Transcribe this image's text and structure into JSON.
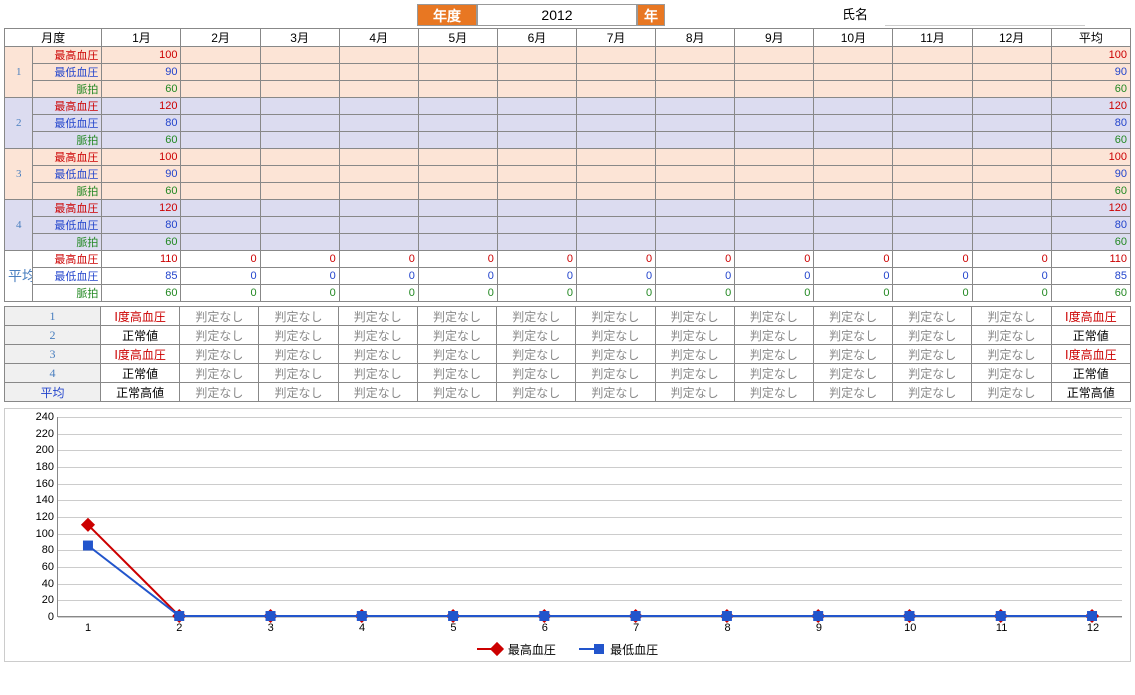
{
  "header": {
    "year_label": "年度",
    "year_value": "2012",
    "year_suffix": "年",
    "name_label": "氏名"
  },
  "columns": {
    "month_header": "月度",
    "months": [
      "1月",
      "2月",
      "3月",
      "4月",
      "5月",
      "6月",
      "7月",
      "8月",
      "9月",
      "10月",
      "11月",
      "12月"
    ],
    "avg": "平均"
  },
  "metrics": {
    "high": "最高血圧",
    "low": "最低血圧",
    "pulse": "脈拍"
  },
  "weeks": [
    {
      "num": "1",
      "bg": "peach",
      "high": [
        "100",
        "",
        "",
        "",
        "",
        "",
        "",
        "",
        "",
        "",
        "",
        "",
        "100"
      ],
      "low": [
        "90",
        "",
        "",
        "",
        "",
        "",
        "",
        "",
        "",
        "",
        "",
        "",
        "90"
      ],
      "pulse": [
        "60",
        "",
        "",
        "",
        "",
        "",
        "",
        "",
        "",
        "",
        "",
        "",
        "60"
      ]
    },
    {
      "num": "2",
      "bg": "lav",
      "high": [
        "120",
        "",
        "",
        "",
        "",
        "",
        "",
        "",
        "",
        "",
        "",
        "",
        "120"
      ],
      "low": [
        "80",
        "",
        "",
        "",
        "",
        "",
        "",
        "",
        "",
        "",
        "",
        "",
        "80"
      ],
      "pulse": [
        "60",
        "",
        "",
        "",
        "",
        "",
        "",
        "",
        "",
        "",
        "",
        "",
        "60"
      ]
    },
    {
      "num": "3",
      "bg": "peach",
      "high": [
        "100",
        "",
        "",
        "",
        "",
        "",
        "",
        "",
        "",
        "",
        "",
        "",
        "100"
      ],
      "low": [
        "90",
        "",
        "",
        "",
        "",
        "",
        "",
        "",
        "",
        "",
        "",
        "",
        "90"
      ],
      "pulse": [
        "60",
        "",
        "",
        "",
        "",
        "",
        "",
        "",
        "",
        "",
        "",
        "",
        "60"
      ]
    },
    {
      "num": "4",
      "bg": "lav",
      "high": [
        "120",
        "",
        "",
        "",
        "",
        "",
        "",
        "",
        "",
        "",
        "",
        "",
        "120"
      ],
      "low": [
        "80",
        "",
        "",
        "",
        "",
        "",
        "",
        "",
        "",
        "",
        "",
        "",
        "80"
      ],
      "pulse": [
        "60",
        "",
        "",
        "",
        "",
        "",
        "",
        "",
        "",
        "",
        "",
        "",
        "60"
      ]
    }
  ],
  "avg_row": {
    "label": "平均",
    "high": [
      "110",
      "0",
      "0",
      "0",
      "0",
      "0",
      "0",
      "0",
      "0",
      "0",
      "0",
      "0",
      "110"
    ],
    "low": [
      "85",
      "0",
      "0",
      "0",
      "0",
      "0",
      "0",
      "0",
      "0",
      "0",
      "0",
      "0",
      "85"
    ],
    "pulse": [
      "60",
      "0",
      "0",
      "0",
      "0",
      "0",
      "0",
      "0",
      "0",
      "0",
      "0",
      "0",
      "60"
    ]
  },
  "judgement": {
    "rows": [
      {
        "label": "1",
        "vals": [
          "Ⅰ度高血圧",
          "判定なし",
          "判定なし",
          "判定なし",
          "判定なし",
          "判定なし",
          "判定なし",
          "判定なし",
          "判定なし",
          "判定なし",
          "判定なし",
          "判定なし",
          "Ⅰ度高血圧"
        ]
      },
      {
        "label": "2",
        "vals": [
          "正常値",
          "判定なし",
          "判定なし",
          "判定なし",
          "判定なし",
          "判定なし",
          "判定なし",
          "判定なし",
          "判定なし",
          "判定なし",
          "判定なし",
          "判定なし",
          "正常値"
        ]
      },
      {
        "label": "3",
        "vals": [
          "Ⅰ度高血圧",
          "判定なし",
          "判定なし",
          "判定なし",
          "判定なし",
          "判定なし",
          "判定なし",
          "判定なし",
          "判定なし",
          "判定なし",
          "判定なし",
          "判定なし",
          "Ⅰ度高血圧"
        ]
      },
      {
        "label": "4",
        "vals": [
          "正常値",
          "判定なし",
          "判定なし",
          "判定なし",
          "判定なし",
          "判定なし",
          "判定なし",
          "判定なし",
          "判定なし",
          "判定なし",
          "判定なし",
          "判定なし",
          "正常値"
        ]
      },
      {
        "label": "平均",
        "vals": [
          "正常高値",
          "判定なし",
          "判定なし",
          "判定なし",
          "判定なし",
          "判定なし",
          "判定なし",
          "判定なし",
          "判定なし",
          "判定なし",
          "判定なし",
          "判定なし",
          "正常高値"
        ]
      }
    ]
  },
  "chart_data": {
    "type": "line",
    "x": [
      1,
      2,
      3,
      4,
      5,
      6,
      7,
      8,
      9,
      10,
      11,
      12
    ],
    "series": [
      {
        "name": "最高血圧",
        "values": [
          110,
          0,
          0,
          0,
          0,
          0,
          0,
          0,
          0,
          0,
          0,
          0
        ],
        "color": "#cc0000",
        "marker": "diamond"
      },
      {
        "name": "最低血圧",
        "values": [
          85,
          0,
          0,
          0,
          0,
          0,
          0,
          0,
          0,
          0,
          0,
          0
        ],
        "color": "#2255cc",
        "marker": "square"
      }
    ],
    "ylim": [
      0,
      240
    ],
    "yticks": [
      0,
      20,
      40,
      60,
      80,
      100,
      120,
      140,
      160,
      180,
      200,
      220,
      240
    ]
  }
}
